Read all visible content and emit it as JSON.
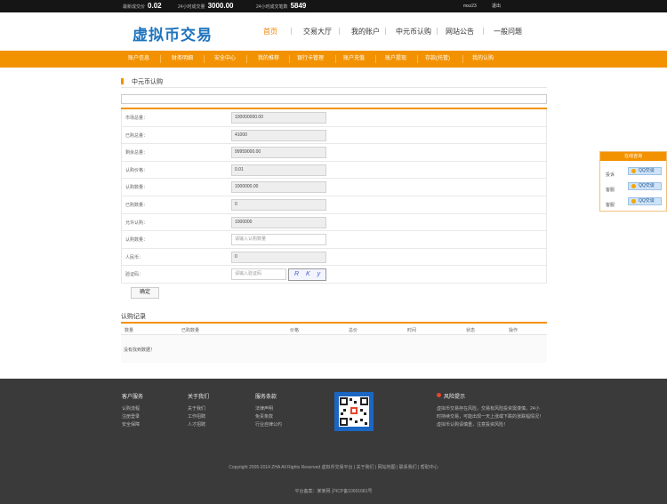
{
  "topbar": {
    "price_label": "最新成交价",
    "price_value": "0.02",
    "volume_label": "24小时成交量",
    "volume_value": "3000.00",
    "count_label": "24小时成交笔数",
    "count_value": "5849",
    "username": "mxz23",
    "logout": "退出"
  },
  "header": {
    "logo": "虚拟币交易",
    "nav": [
      "首页",
      "交易大厅",
      "我的账户",
      "中元币认购",
      "网站公告",
      "一般问题"
    ],
    "active_index": 0
  },
  "subnav": {
    "items": [
      "账户信息",
      "财务明细",
      "安全中心",
      "我的推荐",
      "银行卡管理",
      "账户充值",
      "账户提现",
      "存款(托管)",
      "我的认购"
    ]
  },
  "page": {
    "title": "中元币认购"
  },
  "form": {
    "rows": [
      {
        "label": "市场总量：",
        "value": "100000000.00",
        "kind": "readonly"
      },
      {
        "label": "已购总量：",
        "value": "41000",
        "kind": "readonly"
      },
      {
        "label": "剩余总量：",
        "value": "99959000.00",
        "kind": "readonly"
      },
      {
        "label": "认购价格：",
        "value": "0.01",
        "kind": "readonly"
      },
      {
        "label": "认购数量：",
        "value": "1000000.00",
        "kind": "readonly"
      },
      {
        "label": "已购数量：",
        "value": "0",
        "kind": "readonly"
      },
      {
        "label": "允许认购：",
        "value": "1000000",
        "kind": "readonly"
      },
      {
        "label": "认购数量：",
        "placeholder": "请输入认购数量",
        "kind": "input"
      },
      {
        "label": "人民币：",
        "value": "0",
        "kind": "readonly"
      }
    ],
    "captcha_label": "验证码：",
    "captcha_placeholder": "请输入验证码",
    "captcha_text": "R K y",
    "submit": "确定"
  },
  "records": {
    "title": "认购记录",
    "columns": [
      "数量",
      "已购数量",
      "价格",
      "总价",
      "时间",
      "状态",
      "操作"
    ],
    "empty": "没有找到数据！"
  },
  "qq_panel": {
    "title": "在线咨询",
    "rows": [
      {
        "label": "投诉",
        "button": "QQ交谈"
      },
      {
        "label": "客服",
        "button": "QQ交谈"
      },
      {
        "label": "客服",
        "button": "QQ交谈"
      }
    ]
  },
  "footer": {
    "columns": [
      {
        "heading": "客户服务",
        "links": [
          "认购流程",
          "注册登录",
          "安全保障"
        ]
      },
      {
        "heading": "关于我们",
        "links": [
          "关于我们",
          "工作招聘",
          "人才招聘"
        ]
      },
      {
        "heading": "服务条款",
        "links": [
          "法律声明",
          "免责条款",
          "行业自律公约"
        ]
      }
    ],
    "risk_heading": "风险提示",
    "risk_text": "虚拟币交易存在风险，交易有风险投资需谨慎，24小时持续交易，可能出现一天上涨或下跌的涨跌幅情况！虚拟币认购请慎重，注意投资风险！",
    "copyright": "Copyright 2005-2014 ZHA All Rights Reserved 虚拟币交易平台 | 关于我们 | 网站地图 | 联系我们 | 帮助中心",
    "icp": "平台备案：某某网 沪ICP备10001681号"
  },
  "colors": {
    "accent": "#f39200",
    "logo": "#1e73be",
    "topbar": "#151515",
    "footer": "#3a3a3a"
  }
}
